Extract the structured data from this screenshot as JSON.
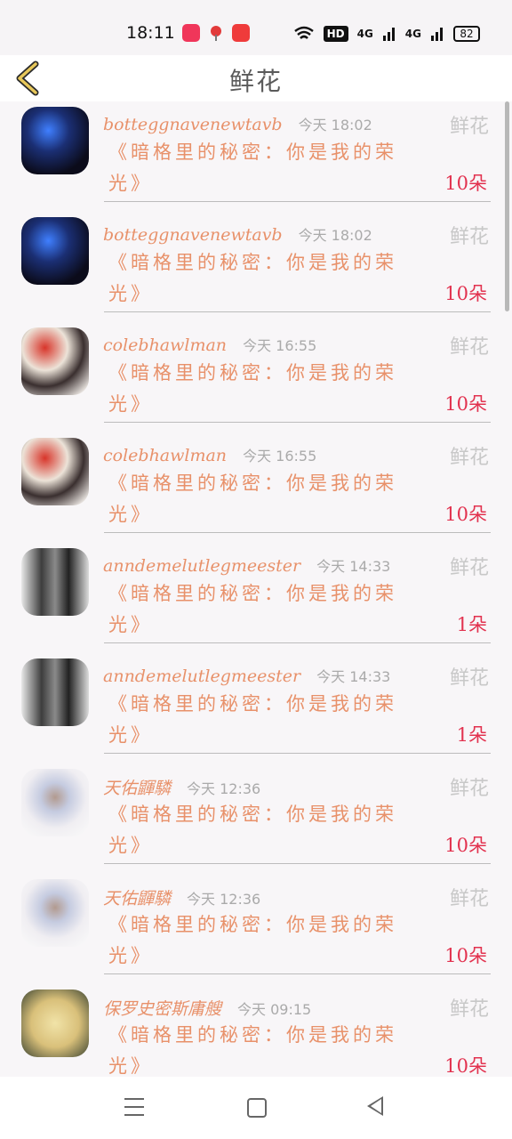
{
  "status_bar": {
    "time": "18:11",
    "hd": "HD",
    "net1": "4G",
    "net2": "4G",
    "battery": "82"
  },
  "header": {
    "title": "鲜花",
    "back_icon": "chevron-left-icon"
  },
  "items": [
    {
      "user": "botteggnavenewtavb",
      "time": "今天 18:02",
      "label": "鲜花",
      "message": "《暗格里的秘密：你是我的荣光》",
      "amount": "10朵",
      "avatar": "blue"
    },
    {
      "user": "botteggnavenewtavb",
      "time": "今天 18:02",
      "label": "鲜花",
      "message": "《暗格里的秘密：你是我的荣光》",
      "amount": "10朵",
      "avatar": "blue"
    },
    {
      "user": "colebhawlman",
      "time": "今天 16:55",
      "label": "鲜花",
      "message": "《暗格里的秘密：你是我的荣光》",
      "amount": "10朵",
      "avatar": "anime"
    },
    {
      "user": "colebhawlman",
      "time": "今天 16:55",
      "label": "鲜花",
      "message": "《暗格里的秘密：你是我的荣光》",
      "amount": "10朵",
      "avatar": "anime"
    },
    {
      "user": "anndemelutlegmeester",
      "time": "今天 14:33",
      "label": "鲜花",
      "message": "《暗格里的秘密：你是我的荣光》",
      "amount": "1朵",
      "avatar": "bw"
    },
    {
      "user": "anndemelutlegmeester",
      "time": "今天 14:33",
      "label": "鲜花",
      "message": "《暗格里的秘密：你是我的荣光》",
      "amount": "1朵",
      "avatar": "bw"
    },
    {
      "user": "天佑鼲驎",
      "time": "今天 12:36",
      "label": "鲜花",
      "message": "《暗格里的秘密：你是我的荣光》",
      "amount": "10朵",
      "avatar": "boy"
    },
    {
      "user": "天佑鼲驎",
      "time": "今天 12:36",
      "label": "鲜花",
      "message": "《暗格里的秘密：你是我的荣光》",
      "amount": "10朵",
      "avatar": "boy"
    },
    {
      "user": "保罗史密斯庸艘",
      "time": "今天 09:15",
      "label": "鲜花",
      "message": "《暗格里的秘密：你是我的荣光》",
      "amount": "10朵",
      "avatar": "fruit"
    }
  ],
  "nav": {
    "menu_icon": "menu-icon",
    "home_icon": "home-square-icon",
    "back_icon": "triangle-back-icon"
  }
}
